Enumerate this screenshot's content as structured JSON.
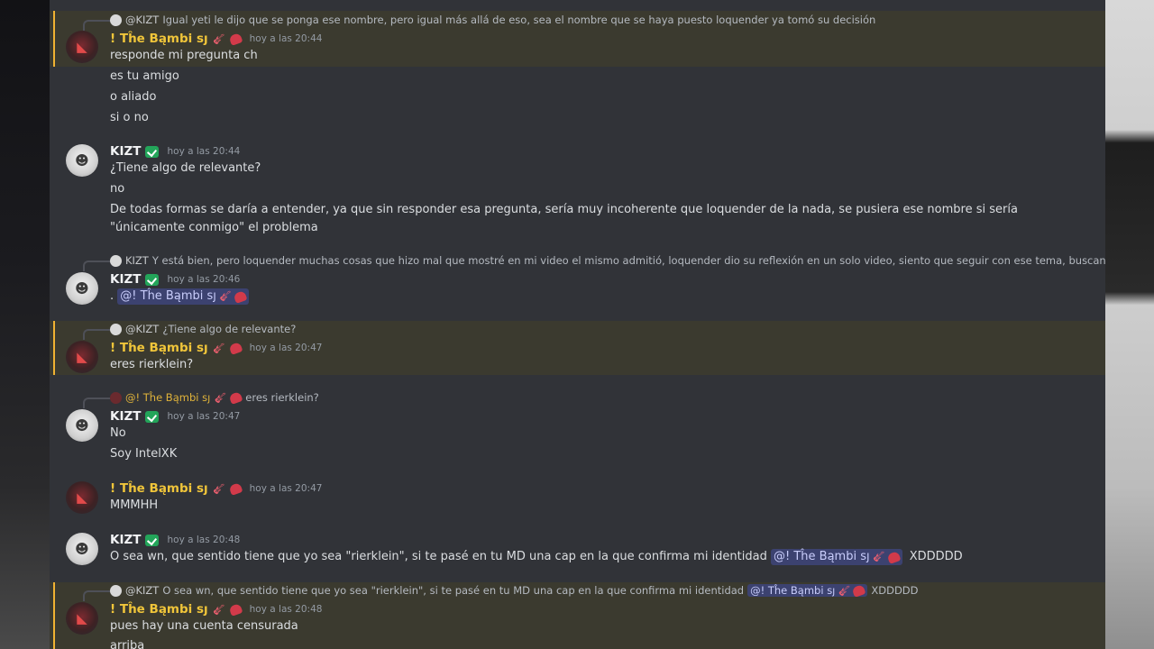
{
  "chat": {
    "messages": [
      {
        "reply": {
          "name": "@KIZT",
          "text": "Igual yeti le dijo que se ponga ese nombre, pero igual más allá de eso, sea el nombre que se haya puesto loquender ya tomó su decisión"
        },
        "author": "! Tĥe Bąmbi sȷ",
        "timestamp": "hoy a las 20:44",
        "lines": [
          "responde mi pregunta ch",
          "es tu amigo",
          "o aliado",
          "si o no"
        ]
      },
      {
        "author": "KIZT",
        "timestamp": "hoy a las 20:44",
        "lines": [
          "¿Tiene algo de relevante?",
          "no",
          "De todas formas se daría a entender, ya que sin responder esa pregunta, sería muy incoherente que loquender de la nada, se pusiera ese nombre si sería \"únicamente conmigo\" el problema"
        ]
      },
      {
        "reply": {
          "name": "KIZT",
          "text": "Y está bien, pero loquender muchas cosas que hizo mal que mostré en  mi video el mismo admitió, loquender dio su reflexión en un solo video, siento que seguir con ese tema, buscando refutar algo ..."
        },
        "author": "KIZT",
        "timestamp": "hoy a las 20:46",
        "line_prefix": ".",
        "mention": "@! Tĥe Bąmbi sȷ"
      },
      {
        "reply": {
          "name": "@KIZT",
          "text": "¿Tiene algo de relevante?"
        },
        "author": "! Tĥe Bąmbi sȷ",
        "timestamp": "hoy a las 20:47",
        "lines": [
          "eres rierklein?"
        ]
      },
      {
        "reply": {
          "name": "@! Tĥe Bąmbi sȷ",
          "text": "eres rierklein?"
        },
        "author": "KIZT",
        "timestamp": "hoy a las 20:47",
        "lines": [
          "No",
          "Soy IntelXK"
        ]
      },
      {
        "author": "! Tĥe Bąmbi sȷ",
        "timestamp": "hoy a las 20:47",
        "lines": [
          "MMMHH"
        ]
      },
      {
        "author": "KIZT",
        "timestamp": "hoy a las 20:48",
        "line_text": "O sea wn, que sentido tiene que yo sea \"rierklein\", si te pasé en tu MD una cap en la que confirma mi identidad",
        "mention": "@! Tĥe Bąmbi sȷ",
        "line_suffix": "XDDDDD"
      },
      {
        "reply": {
          "name": "@KIZT",
          "text": "O sea wn, que sentido tiene que yo sea \"rierklein\", si te pasé en tu MD una cap en la que confirma mi identidad",
          "mention": "@! Tĥe Bąmbi sȷ",
          "suffix": "XDDDDD"
        },
        "author": "! Tĥe Bąmbi sȷ",
        "timestamp": "hoy a las 20:48",
        "lines": [
          "pues hay una cuenta censurada",
          "arriba"
        ]
      }
    ]
  },
  "colors": {
    "chat_bg": "#313338",
    "mention_bg": "#3b3a2f",
    "mention_bar": "#f0b232",
    "gold_name": "#f0c53a",
    "chip_bg": "#3c4270"
  },
  "icons": {
    "kizt_badge": "green-check-badge",
    "bambi_emojis": [
      "guitar-icon",
      "heart-icon"
    ]
  }
}
